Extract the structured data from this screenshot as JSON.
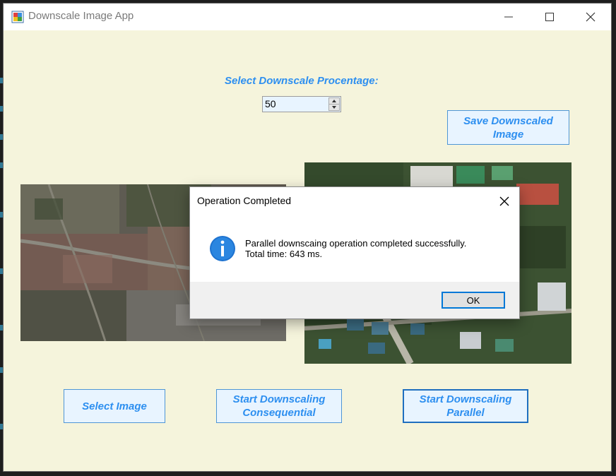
{
  "window": {
    "title": "Downscale Image App"
  },
  "controls": {
    "percentage_label": "Select Downscale Procentage:",
    "percentage_value": "50",
    "save_button": [
      "Save Downscaled",
      "Image"
    ],
    "select_button": "Select Image",
    "consequential_button": [
      "Start Downscaling",
      "Consequential"
    ],
    "parallel_button": [
      "Start Downscaling",
      "Parallel"
    ]
  },
  "dialog": {
    "title": "Operation Completed",
    "message_line1": "Parallel downscaing operation completed successfully.",
    "message_line2": "Total time: 643 ms.",
    "ok_label": "OK"
  },
  "colors": {
    "window_bg": "#f5f4dc",
    "accent_text": "#2d8ff0",
    "button_bg": "#e8f4ff",
    "dialog_accent": "#0078d7"
  },
  "icons": {
    "app": "app-icon",
    "minimize": "minimize-icon",
    "maximize": "maximize-icon",
    "close": "close-icon",
    "info": "info-icon"
  }
}
